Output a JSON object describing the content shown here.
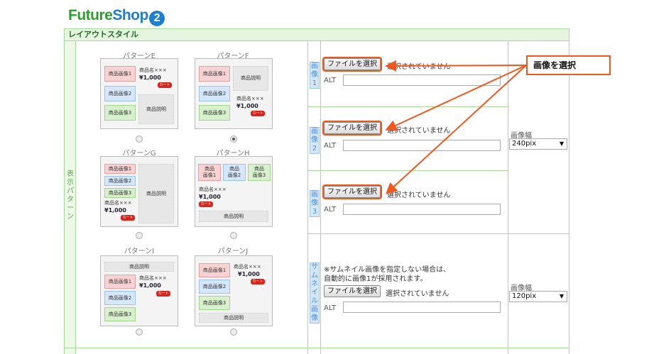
{
  "logo": {
    "part1": "Future",
    "part2": "Shop",
    "num": "2"
  },
  "section": {
    "title": "レイアウトスタイル"
  },
  "display_pattern_label": "表示パターン",
  "patterns": [
    {
      "name": "パターンE",
      "selected": false
    },
    {
      "name": "パターンF",
      "selected": true
    },
    {
      "name": "パターンG",
      "selected": false
    },
    {
      "name": "パターンH",
      "selected": false
    },
    {
      "name": "パターンI",
      "selected": false
    },
    {
      "name": "パターンJ",
      "selected": false
    }
  ],
  "card_text": {
    "img1": "商品画像1",
    "img2": "商品画像2",
    "img3": "商品画像3",
    "product_name": "商品名×××",
    "price": "¥1,000",
    "cart": "カート",
    "desc": "商品説明",
    "img_short": "商品",
    "img_1": "画像1",
    "img_2": "画像2",
    "img_3": "画像3"
  },
  "image_rows": [
    {
      "label": "画像1",
      "button": "ファイルを選択",
      "status": "選択されていません",
      "alt": "ALT"
    },
    {
      "label": "画像2",
      "button": "ファイルを選択",
      "status": "選択されていません",
      "alt": "ALT"
    },
    {
      "label": "画像3",
      "button": "ファイルを選択",
      "status": "選択されていません",
      "alt": "ALT"
    },
    {
      "label": "サムネイル画像",
      "button": "ファイルを選択",
      "status": "選択されていません",
      "alt": "ALT"
    }
  ],
  "thumb_note": {
    "line1": "※サムネイル画像を指定しない場合は、",
    "line2": "自動的に画像1が採用されます。"
  },
  "width_fields": [
    {
      "label": "画像幅",
      "value": "240pix"
    },
    {
      "label": "画像幅",
      "value": "120pix"
    }
  ],
  "callout": {
    "text": "画像を選択"
  },
  "colors": {
    "accent": "#f2581d",
    "green_border": "#a9d89b",
    "header_bg": "#e5f5df",
    "cart_red": "#d9241b"
  }
}
